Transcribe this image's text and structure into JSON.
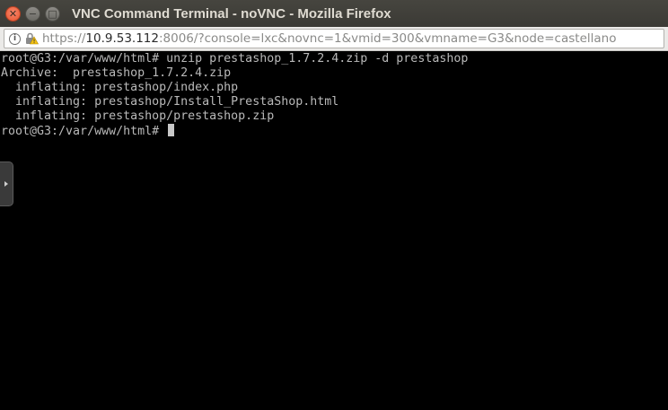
{
  "window": {
    "title": "VNC Command Terminal - noVNC - Mozilla Firefox",
    "close_glyph": "✕",
    "min_glyph": "−",
    "max_glyph": "□"
  },
  "urlbar": {
    "scheme": "https://",
    "host": "10.9.53.112",
    "rest": ":8006/?console=lxc&novnc=1&vmid=300&vmname=G3&node=castellano"
  },
  "terminal": {
    "lines": [
      "root@G3:/var/www/html# unzip prestashop_1.7.2.4.zip -d prestashop",
      "Archive:  prestashop_1.7.2.4.zip",
      "  inflating: prestashop/index.php",
      "  inflating: prestashop/Install_PrestaShop.html",
      "  inflating: prestashop/prestashop.zip"
    ],
    "prompt": "root@G3:/var/www/html# "
  },
  "colors": {
    "terminal_bg": "#000000",
    "terminal_fg": "#b9b9b9",
    "titlebar_bg": "#3c3b37",
    "close_button": "#e9552f"
  },
  "icons": {
    "info": "info-icon",
    "lock": "lock-warning-icon",
    "side": "chevron-right-icon"
  }
}
